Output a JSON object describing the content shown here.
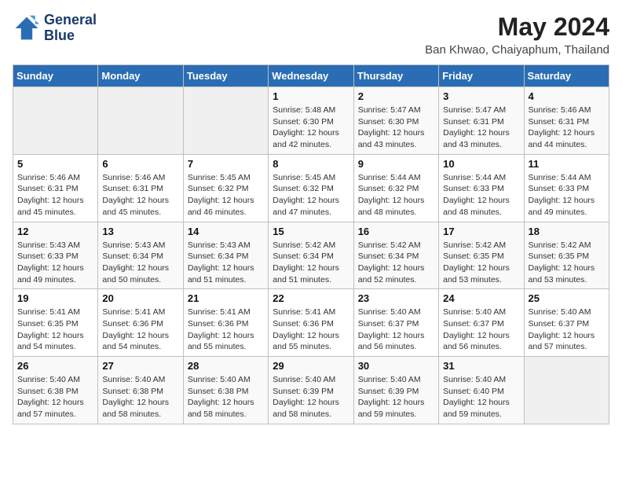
{
  "header": {
    "logo_line1": "General",
    "logo_line2": "Blue",
    "title": "May 2024",
    "subtitle": "Ban Khwao, Chaiyaphum, Thailand"
  },
  "weekdays": [
    "Sunday",
    "Monday",
    "Tuesday",
    "Wednesday",
    "Thursday",
    "Friday",
    "Saturday"
  ],
  "weeks": [
    [
      {
        "day": "",
        "info": ""
      },
      {
        "day": "",
        "info": ""
      },
      {
        "day": "",
        "info": ""
      },
      {
        "day": "1",
        "info": "Sunrise: 5:48 AM\nSunset: 6:30 PM\nDaylight: 12 hours\nand 42 minutes."
      },
      {
        "day": "2",
        "info": "Sunrise: 5:47 AM\nSunset: 6:30 PM\nDaylight: 12 hours\nand 43 minutes."
      },
      {
        "day": "3",
        "info": "Sunrise: 5:47 AM\nSunset: 6:31 PM\nDaylight: 12 hours\nand 43 minutes."
      },
      {
        "day": "4",
        "info": "Sunrise: 5:46 AM\nSunset: 6:31 PM\nDaylight: 12 hours\nand 44 minutes."
      }
    ],
    [
      {
        "day": "5",
        "info": "Sunrise: 5:46 AM\nSunset: 6:31 PM\nDaylight: 12 hours\nand 45 minutes."
      },
      {
        "day": "6",
        "info": "Sunrise: 5:46 AM\nSunset: 6:31 PM\nDaylight: 12 hours\nand 45 minutes."
      },
      {
        "day": "7",
        "info": "Sunrise: 5:45 AM\nSunset: 6:32 PM\nDaylight: 12 hours\nand 46 minutes."
      },
      {
        "day": "8",
        "info": "Sunrise: 5:45 AM\nSunset: 6:32 PM\nDaylight: 12 hours\nand 47 minutes."
      },
      {
        "day": "9",
        "info": "Sunrise: 5:44 AM\nSunset: 6:32 PM\nDaylight: 12 hours\nand 48 minutes."
      },
      {
        "day": "10",
        "info": "Sunrise: 5:44 AM\nSunset: 6:33 PM\nDaylight: 12 hours\nand 48 minutes."
      },
      {
        "day": "11",
        "info": "Sunrise: 5:44 AM\nSunset: 6:33 PM\nDaylight: 12 hours\nand 49 minutes."
      }
    ],
    [
      {
        "day": "12",
        "info": "Sunrise: 5:43 AM\nSunset: 6:33 PM\nDaylight: 12 hours\nand 49 minutes."
      },
      {
        "day": "13",
        "info": "Sunrise: 5:43 AM\nSunset: 6:34 PM\nDaylight: 12 hours\nand 50 minutes."
      },
      {
        "day": "14",
        "info": "Sunrise: 5:43 AM\nSunset: 6:34 PM\nDaylight: 12 hours\nand 51 minutes."
      },
      {
        "day": "15",
        "info": "Sunrise: 5:42 AM\nSunset: 6:34 PM\nDaylight: 12 hours\nand 51 minutes."
      },
      {
        "day": "16",
        "info": "Sunrise: 5:42 AM\nSunset: 6:34 PM\nDaylight: 12 hours\nand 52 minutes."
      },
      {
        "day": "17",
        "info": "Sunrise: 5:42 AM\nSunset: 6:35 PM\nDaylight: 12 hours\nand 53 minutes."
      },
      {
        "day": "18",
        "info": "Sunrise: 5:42 AM\nSunset: 6:35 PM\nDaylight: 12 hours\nand 53 minutes."
      }
    ],
    [
      {
        "day": "19",
        "info": "Sunrise: 5:41 AM\nSunset: 6:35 PM\nDaylight: 12 hours\nand 54 minutes."
      },
      {
        "day": "20",
        "info": "Sunrise: 5:41 AM\nSunset: 6:36 PM\nDaylight: 12 hours\nand 54 minutes."
      },
      {
        "day": "21",
        "info": "Sunrise: 5:41 AM\nSunset: 6:36 PM\nDaylight: 12 hours\nand 55 minutes."
      },
      {
        "day": "22",
        "info": "Sunrise: 5:41 AM\nSunset: 6:36 PM\nDaylight: 12 hours\nand 55 minutes."
      },
      {
        "day": "23",
        "info": "Sunrise: 5:40 AM\nSunset: 6:37 PM\nDaylight: 12 hours\nand 56 minutes."
      },
      {
        "day": "24",
        "info": "Sunrise: 5:40 AM\nSunset: 6:37 PM\nDaylight: 12 hours\nand 56 minutes."
      },
      {
        "day": "25",
        "info": "Sunrise: 5:40 AM\nSunset: 6:37 PM\nDaylight: 12 hours\nand 57 minutes."
      }
    ],
    [
      {
        "day": "26",
        "info": "Sunrise: 5:40 AM\nSunset: 6:38 PM\nDaylight: 12 hours\nand 57 minutes."
      },
      {
        "day": "27",
        "info": "Sunrise: 5:40 AM\nSunset: 6:38 PM\nDaylight: 12 hours\nand 58 minutes."
      },
      {
        "day": "28",
        "info": "Sunrise: 5:40 AM\nSunset: 6:38 PM\nDaylight: 12 hours\nand 58 minutes."
      },
      {
        "day": "29",
        "info": "Sunrise: 5:40 AM\nSunset: 6:39 PM\nDaylight: 12 hours\nand 58 minutes."
      },
      {
        "day": "30",
        "info": "Sunrise: 5:40 AM\nSunset: 6:39 PM\nDaylight: 12 hours\nand 59 minutes."
      },
      {
        "day": "31",
        "info": "Sunrise: 5:40 AM\nSunset: 6:40 PM\nDaylight: 12 hours\nand 59 minutes."
      },
      {
        "day": "",
        "info": ""
      }
    ]
  ]
}
